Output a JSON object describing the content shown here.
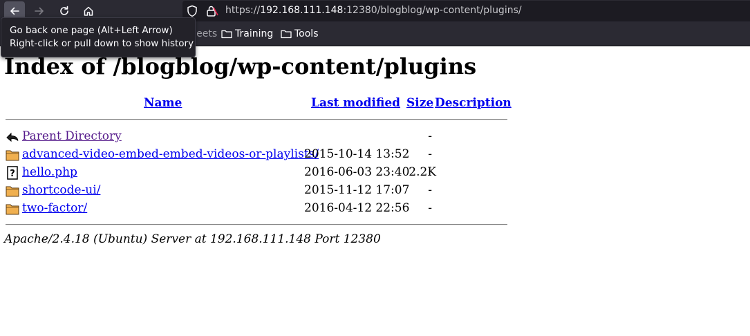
{
  "browser": {
    "url_prefix": "https://",
    "url_host": "192.168.111.148",
    "url_rest": ":12380/blogblog/wp-content/plugins/",
    "tooltip_line1": "Go back one page (Alt+Left Arrow)",
    "tooltip_line2": "Right-click or pull down to show history",
    "bookmarks": [
      "heat sheets",
      "Training",
      "Tools"
    ]
  },
  "page": {
    "title": "Index of /blogblog/wp-content/plugins",
    "columns": {
      "name": "Name",
      "last_modified": "Last modified",
      "size": "Size",
      "description": "Description"
    },
    "rows": [
      {
        "name": "Parent Directory",
        "modified": "",
        "size": "-",
        "icon": "back-icon"
      },
      {
        "name": "advanced-video-embed-embed-videos-or-playlists/",
        "modified": "2015-10-14 13:52",
        "size": "-",
        "icon": "folder-icon"
      },
      {
        "name": "hello.php",
        "modified": "2016-06-03 23:40",
        "size": "2.2K",
        "icon": "unknown-file-icon"
      },
      {
        "name": "shortcode-ui/",
        "modified": "2015-11-12 17:07",
        "size": "-",
        "icon": "folder-icon"
      },
      {
        "name": "two-factor/",
        "modified": "2016-04-12 22:56",
        "size": "-",
        "icon": "folder-icon"
      }
    ],
    "footer": "Apache/2.4.18 (Ubuntu) Server at 192.168.111.148 Port 12380"
  }
}
